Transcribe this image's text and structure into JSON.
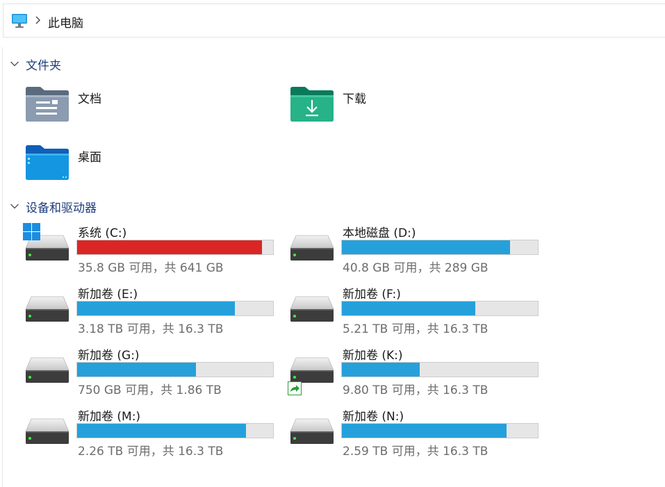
{
  "address": {
    "icon": "computer-icon",
    "breadcrumb": "此电脑"
  },
  "folders_section": {
    "title": "文件夹",
    "items": [
      {
        "name": "文档",
        "icon": "documents-folder-icon"
      },
      {
        "name": "下载",
        "icon": "downloads-folder-icon"
      },
      {
        "name": "桌面",
        "icon": "desktop-folder-icon"
      }
    ]
  },
  "devices_section": {
    "title": "设备和驱动器",
    "drives": [
      {
        "name": "系统 (C:)",
        "space": "35.8 GB 可用，共 641 GB",
        "used_fraction": 0.944,
        "low_space": true,
        "system": true
      },
      {
        "name": "本地磁盘 (D:)",
        "space": "40.8 GB 可用，共 289 GB",
        "used_fraction": 0.859
      },
      {
        "name": "新加卷 (E:)",
        "space": "3.18 TB 可用，共 16.3 TB",
        "used_fraction": 0.805
      },
      {
        "name": "新加卷 (F:)",
        "space": "5.21 TB 可用，共 16.3 TB",
        "used_fraction": 0.68
      },
      {
        "name": "新加卷 (G:)",
        "space": "750 GB 可用，共 1.86 TB",
        "used_fraction": 0.606
      },
      {
        "name": "新加卷 (K:)",
        "space": "9.80 TB 可用，共 16.3 TB",
        "used_fraction": 0.398,
        "shared": true
      },
      {
        "name": "新加卷 (M:)",
        "space": "2.26 TB 可用，共 16.3 TB",
        "used_fraction": 0.861
      },
      {
        "name": "新加卷 (N:)",
        "space": "2.59 TB 可用，共 16.3 TB",
        "used_fraction": 0.841
      }
    ]
  },
  "colors": {
    "bar_normal": "#26a0da",
    "bar_low": "#da2626",
    "bar_track": "#e6e6e6",
    "section_title": "#1e3d7a"
  }
}
